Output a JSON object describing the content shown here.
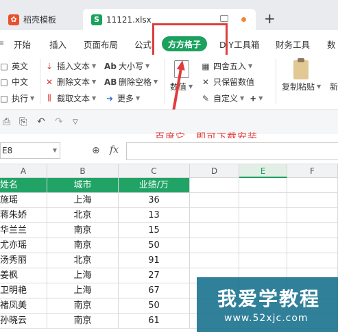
{
  "tabs": [
    {
      "label": "稻壳模板",
      "icon": "docer-icon"
    },
    {
      "label": "11121.xlsx",
      "icon": "spreadsheet-icon"
    }
  ],
  "menu": {
    "items": [
      "开始",
      "插入",
      "页面布局",
      "公式",
      "方方格子",
      "DIY工具箱",
      "财务工具",
      "数"
    ],
    "active": "方方格子"
  },
  "ribbon": {
    "col1": [
      "英文",
      "中文",
      "执行"
    ],
    "col2": [
      "插入文本",
      "删除文本",
      "截取文本"
    ],
    "col3": [
      "大小写",
      "删除空格",
      "更多"
    ],
    "numeric_label": "数值",
    "col4": [
      "四舍五入",
      "只保留数值",
      "自定义"
    ],
    "paste_label": "复制粘贴",
    "new_label": "新"
  },
  "annotation": "百度它，即可下载安装",
  "formula_bar": {
    "name_box": "E8",
    "fx": "fx",
    "value": ""
  },
  "columns": [
    "A",
    "B",
    "C",
    "D",
    "E",
    "F"
  ],
  "selected_column": "E",
  "table": {
    "headers": [
      "姓名",
      "城市",
      "业绩/万"
    ],
    "rows": [
      [
        "施瑶",
        "上海",
        "36"
      ],
      [
        "蒋朱娇",
        "北京",
        "13"
      ],
      [
        "华兰兰",
        "南京",
        "15"
      ],
      [
        "尤亦瑶",
        "南京",
        "50"
      ],
      [
        "汤秀丽",
        "北京",
        "91"
      ],
      [
        "姜枫",
        "上海",
        "27"
      ],
      [
        "卫明艳",
        "上海",
        "67"
      ],
      [
        "褚凤美",
        "南京",
        "50"
      ],
      [
        "孙晓云",
        "南京",
        "61"
      ]
    ]
  },
  "watermark": {
    "title": "我爱学教程",
    "url": "www.52xjc.com"
  },
  "colors": {
    "accent": "#1aa15e",
    "header_fill": "#21a366",
    "annotation": "#e03c3c"
  }
}
